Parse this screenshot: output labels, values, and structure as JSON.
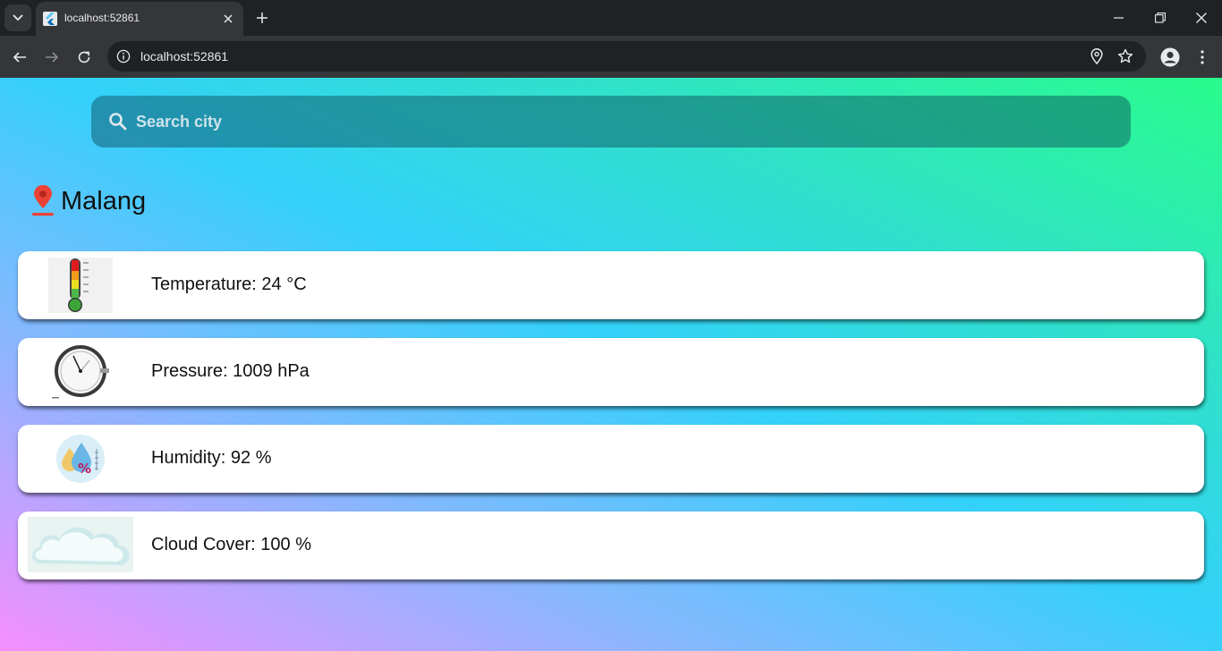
{
  "browser": {
    "tab_title": "localhost:52861",
    "url": "localhost:52861"
  },
  "search": {
    "placeholder": "Search city",
    "value": ""
  },
  "location": {
    "city": "Malang"
  },
  "weather_cards": [
    {
      "label": "Temperature: 24 °C",
      "icon": "thermometer-icon"
    },
    {
      "label": "Pressure: 1009 hPa",
      "icon": "barometer-icon"
    },
    {
      "label": "Humidity: 92 %",
      "icon": "humidity-icon"
    },
    {
      "label": "Cloud Cover: 100 %",
      "icon": "cloud-icon"
    }
  ],
  "colors": {
    "gradient_bottom_left": "#f58eff",
    "gradient_middle": "#33d1fb",
    "gradient_top_right": "#2afc8c",
    "pin_red": "#ea4335",
    "chrome_dark": "#202124",
    "chrome_toolbar": "#35363a"
  }
}
